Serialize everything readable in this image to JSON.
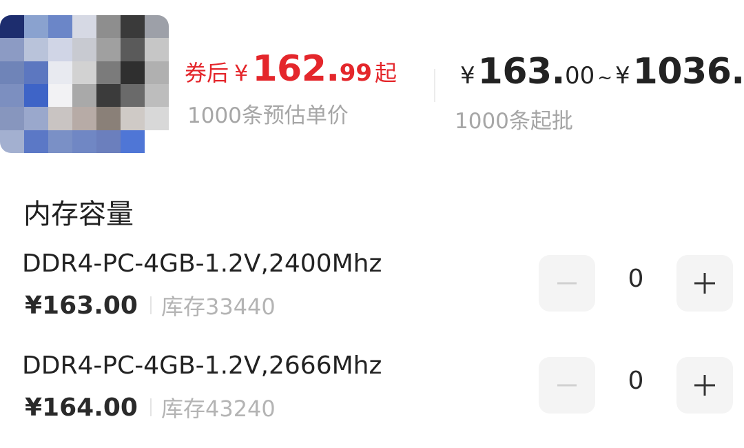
{
  "product": {
    "thumbnail_colors": [
      "#1d2d6e",
      "#8aa2cf",
      "#6b86c8",
      "#d6d9e4",
      "#8e8e8e",
      "#3a3a3a",
      "#9da0a8",
      "#8c9bc4",
      "#b9c3da",
      "#d0d5e6",
      "#c8cad1",
      "#a0a0a0",
      "#5a5a5a",
      "#c6c6c6",
      "#6f84b8",
      "#5c77c0",
      "#e8eaf0",
      "#d2d2d2",
      "#7b7b7b",
      "#2f2f2f",
      "#b0b0b0",
      "#7c8fc0",
      "#3e64c7",
      "#f2f2f4",
      "#a9a9a9",
      "#3b3b3b",
      "#6a6a6a",
      "#bdbdbd",
      "#8796be",
      "#9aa8cc",
      "#c9c4c2",
      "#b7aba6",
      "#8a8078",
      "#cfcac6",
      "#d8d8d8",
      "#a3b0d0",
      "#5b78c6",
      "#7a90c6",
      "#7087c4",
      "#6b7fbd",
      "#4f76d6",
      "#ffffff"
    ]
  },
  "pricing": {
    "coupon_label": "券后",
    "coupon_currency": "¥",
    "coupon_price_int": "162.",
    "coupon_price_dec": "99",
    "coupon_suffix": "起",
    "coupon_note": "1000条预估单价",
    "range_currency_1": "¥",
    "range_low_int": "163.",
    "range_low_dec": "00",
    "range_tilde": "~",
    "range_currency_2": "¥",
    "range_high_int": "1036.",
    "range_note": "1000条起批"
  },
  "section_title": "内存容量",
  "skus": [
    {
      "name": "DDR4-PC-4GB-1.2V,2400Mhz",
      "price": "¥163.00",
      "stock": "库存33440",
      "quantity": "0"
    },
    {
      "name": "DDR4-PC-4GB-1.2V,2666Mhz",
      "price": "¥164.00",
      "stock": "库存43240",
      "quantity": "0"
    }
  ],
  "colors": {
    "accent_red": "#e4262b",
    "muted_text": "#a6a6a6",
    "stepper_bg": "#f4f4f4"
  }
}
